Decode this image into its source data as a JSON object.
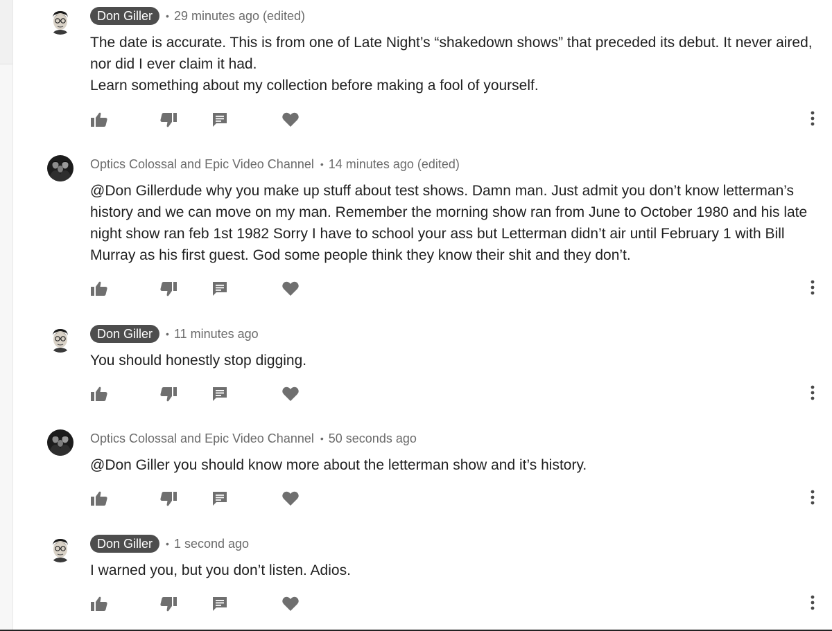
{
  "comments": [
    {
      "author": "Don Giller",
      "author_style": "chip",
      "time": "29 minutes ago (edited)",
      "avatar_icon": "face-avatar-icon",
      "lines": [
        "The date is accurate. This is from one of Late Night’s “shakedown shows” that preceded its debut. It never aired, nor did I ever claim it had.",
        "Learn something about my collection before making a fool of yourself."
      ]
    },
    {
      "author": "Optics Colossal and Epic Video Channel",
      "author_style": "plain",
      "time": "14 minutes ago (edited)",
      "avatar_icon": "group-photo-avatar-icon",
      "lines": [
        "@Don Gillerdude why you make up stuff about test shows.  Damn man. Just admit you don’t know letterman’s history and we can move on my man.   Remember the morning show ran from June to October 1980 and his late night show ran feb 1st 1982 Sorry I have to school your ass but   Letterman didn’t air until February 1 with Bill Murray as his first guest.  God some people think they know their shit and they don’t."
      ]
    },
    {
      "author": "Don Giller",
      "author_style": "chip",
      "time": "11 minutes ago",
      "avatar_icon": "face-avatar-icon",
      "lines": [
        "You should honestly stop digging."
      ]
    },
    {
      "author": "Optics Colossal and Epic Video Channel",
      "author_style": "plain",
      "time": "50 seconds ago",
      "avatar_icon": "group-photo-avatar-icon",
      "lines": [
        "@Don Giller you should know more about the letterman show and it’s history."
      ]
    },
    {
      "author": "Don Giller",
      "author_style": "chip",
      "time": "1 second ago",
      "avatar_icon": "face-avatar-icon",
      "lines": [
        "I warned you, but you don’t listen. Adios."
      ]
    }
  ],
  "action_icons": [
    "thumbs-up-icon",
    "thumbs-down-icon",
    "reply-icon",
    "heart-icon",
    "more-vertical-icon"
  ],
  "colors": {
    "chip_background": "#4d4d4d",
    "meta_text": "#6b6b6b",
    "icon_gray": "#6f6f6f",
    "body_text": "#1f1f1f"
  },
  "separator": "•"
}
